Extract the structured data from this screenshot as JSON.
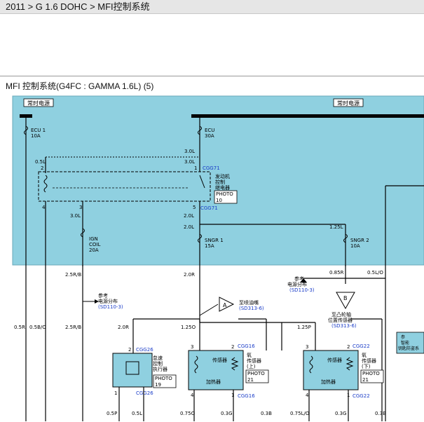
{
  "breadcrumb": {
    "text": "2011 > G 1.6 DOHC > MFI控制系统"
  },
  "title": "MFI 控制系统(G4FC : GAMMA 1.6L) (5)",
  "power": {
    "left_label": "常时电源",
    "right_label": "常时电源"
  },
  "fuses": {
    "ecu1": {
      "name": "ECU 1",
      "rating": "10A"
    },
    "ecu": {
      "name": "ECU",
      "rating": "30A"
    },
    "ign_coil": {
      "name": "IGN",
      "name2": "COIL",
      "rating": "20A"
    },
    "sngr1": {
      "name": "SNGR 1",
      "rating": "15A"
    },
    "sngr2": {
      "name": "SNGR 2",
      "rating": "10A"
    }
  },
  "relay": {
    "line1": "发动机",
    "line2": "控制",
    "line3": "继电器",
    "photo": "PHOTO",
    "photo_num": "10"
  },
  "connectors": {
    "cgg71": "CGG71",
    "cgg26": "CGG26",
    "cgg16": "CGG16",
    "cgg22": "CGG22"
  },
  "wires": {
    "w30L_a": "3.0L",
    "w30L_b": "3.0L",
    "w05L_top": "0.5L",
    "w30L_c": "3.0L",
    "w20L_a": "2.0L",
    "w20L_b": "2.0L",
    "w125L": "1.25L",
    "w25RB_a": "2.5R/B",
    "w20R": "2.0R",
    "w085R": "0.85R",
    "w05LO": "0.5L/O",
    "w05R": "0.5R",
    "w05BO": "0.5B/O",
    "w25RB_b": "2.5R/B",
    "w20R_b": "2.0R",
    "w125O": "1.25O",
    "w125P": "1.25P",
    "w05P": "0.5P",
    "w05L_bot": "0.5L",
    "w075O": "0.75O",
    "w03G_a": "0.3G",
    "w03B_a": "0.3B",
    "w075LO": "0.75L/O",
    "w03G_b": "0.3G",
    "w03B_b": "0.3B"
  },
  "pins": {
    "p2a": "2",
    "p1a": "1",
    "p4a": "4",
    "p3a": "3",
    "p5a": "5",
    "p2b": "2",
    "p3b": "3",
    "p4b": "4",
    "p1b": "1",
    "p3c": "3",
    "p2c": "2",
    "p4c": "4",
    "p1c": "1",
    "p1d": "1"
  },
  "refs": {
    "ref1_l1": "参考",
    "ref1_l2": "电源分布",
    "ref1_l3": "(SD110-3)",
    "ref2_l1": "参考",
    "ref2_l2": "电源分布",
    "ref2_l3": "(SD110-3)",
    "a_label": "A",
    "a_text": "至喷油嘴",
    "a_ref": "(SD313-6)",
    "b_label": "B",
    "b_text1": "至凸轮轴",
    "b_text2": "位置传感器",
    "b_ref": "(SD313-6)"
  },
  "components": {
    "actuator": {
      "l1": "怠速",
      "l2": "控制",
      "l3": "执行器",
      "photo": "PHOTO",
      "num": "19"
    },
    "o2_up": {
      "inner1": "传感器",
      "inner2": "加热器",
      "l1": "氧",
      "l2": "传感器",
      "l3": "(上)",
      "photo": "PHOTO",
      "num": "21"
    },
    "o2_down": {
      "inner1": "传感器",
      "inner2": "加热器",
      "l1": "氧",
      "l2": "传感器",
      "l3": "(下)",
      "photo": "PHOTO",
      "num": "21"
    },
    "right_box": {
      "l1": "参",
      "l2": "智能",
      "l3": "钥匙防盗系"
    }
  },
  "colors": {
    "panel": "#8fd0e0",
    "wire": "#000000",
    "conn": "#1a3cc8"
  }
}
